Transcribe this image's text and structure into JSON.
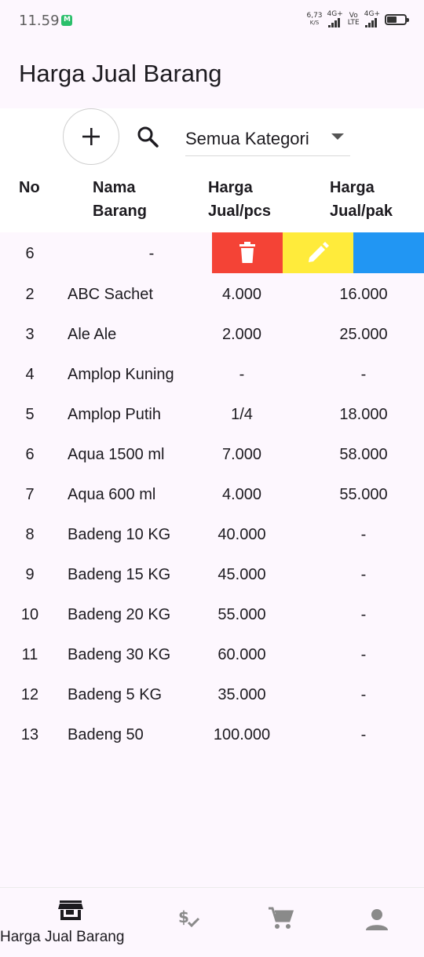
{
  "status_bar": {
    "time": "11.59",
    "net_speed_value": "6,73",
    "net_speed_unit": "K/S",
    "sim1_label": "4G+",
    "volte_label": "Vo",
    "lte_label": "LTE",
    "sim2_label": "4G+"
  },
  "app_bar": {
    "title": "Harga Jual Barang"
  },
  "toolbar": {
    "add_icon": "plus-icon",
    "search_icon": "search-icon",
    "category_selected": "Semua Kategori"
  },
  "table": {
    "headers": {
      "no": "No",
      "name_line1": "Nama",
      "name_line2": "Barang",
      "pcs_line1": "Harga",
      "pcs_line2": "Jual/pcs",
      "pak_line1": "Harga",
      "pak_line2": "Jual/pak"
    },
    "swiped_row": {
      "no": "6",
      "name": "-"
    },
    "rows": [
      {
        "no": "2",
        "name": "ABC Sachet",
        "pcs": "4.000",
        "pak": "16.000"
      },
      {
        "no": "3",
        "name": "Ale Ale",
        "pcs": "2.000",
        "pak": "25.000"
      },
      {
        "no": "4",
        "name": "Amplop Kuning",
        "pcs": "-",
        "pak": "-"
      },
      {
        "no": "5",
        "name": "Amplop Putih",
        "pcs": "1/4",
        "pak": "18.000"
      },
      {
        "no": "6",
        "name": "Aqua 1500 ml",
        "pcs": "7.000",
        "pak": "58.000"
      },
      {
        "no": "7",
        "name": "Aqua 600 ml",
        "pcs": "4.000",
        "pak": "55.000"
      },
      {
        "no": "8",
        "name": "Badeng 10 KG",
        "pcs": "40.000",
        "pak": "-"
      },
      {
        "no": "9",
        "name": "Badeng 15 KG",
        "pcs": "45.000",
        "pak": "-"
      },
      {
        "no": "10",
        "name": "Badeng 20 KG",
        "pcs": "55.000",
        "pak": "-"
      },
      {
        "no": "11",
        "name": "Badeng 30 KG",
        "pcs": "60.000",
        "pak": "-"
      },
      {
        "no": "12",
        "name": "Badeng 5 KG",
        "pcs": "35.000",
        "pak": "-"
      },
      {
        "no": "13",
        "name": "Badeng 50",
        "pcs": "100.000",
        "pak": "-"
      }
    ]
  },
  "actions": {
    "delete_color": "#f44336",
    "edit_color": "#ffeb3b",
    "more_color": "#2196f3"
  },
  "bottom_nav": {
    "active_label": "Harga Jual Barang",
    "items": [
      "store-icon",
      "price-check-icon",
      "cart-icon",
      "person-icon"
    ]
  }
}
